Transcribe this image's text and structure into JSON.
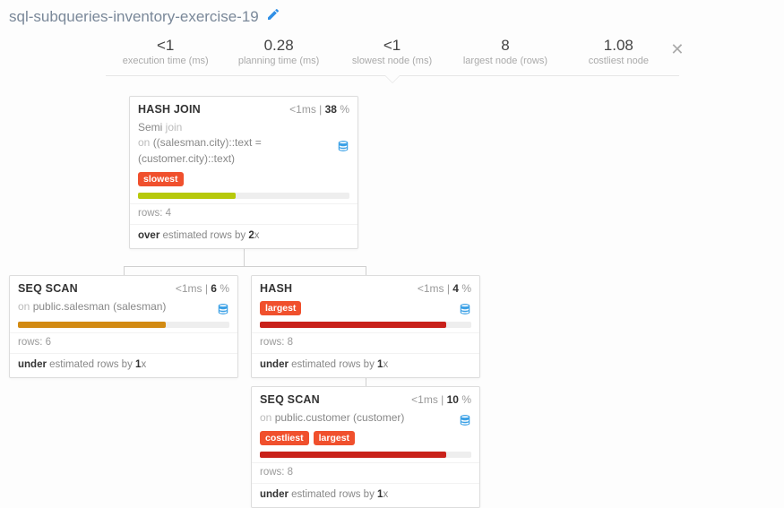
{
  "title": "sql-subqueries-inventory-exercise-19",
  "stats": {
    "execution_time": {
      "value": "<1",
      "label": "execution time (ms)"
    },
    "planning_time": {
      "value": "0.28",
      "label": "planning time (ms)"
    },
    "slowest_node": {
      "value": "<1",
      "label": "slowest node (ms)"
    },
    "largest_node": {
      "value": "8",
      "label": "largest node (rows)"
    },
    "costliest_node": {
      "value": "1.08",
      "label": "costliest node"
    }
  },
  "nodes": {
    "hashjoin": {
      "name": "HASH JOIN",
      "time": "<1ms",
      "pct": "38",
      "join_kind_prefix": "Semi",
      "join_kind_suffix": " join",
      "on_prefix": "on ",
      "on_cond": "((salesman.city)::text = (customer.city)::text)",
      "tags": [
        "slowest"
      ],
      "bar_color": "#b7c90a",
      "bar_width": "46%",
      "rows": "rows: 4",
      "est_lead": "over",
      "est_mid": " estimated rows by ",
      "est_num": "2",
      "est_suffix": "x"
    },
    "seqscan_salesman": {
      "name": "SEQ SCAN",
      "time": "<1ms",
      "pct": "6",
      "on_prefix": "on ",
      "on_text": "public.salesman (salesman)",
      "bar_color": "#d28a12",
      "bar_width": "70%",
      "rows": "rows: 6",
      "est_lead": "under",
      "est_mid": " estimated rows by ",
      "est_num": "1",
      "est_suffix": "x"
    },
    "hash": {
      "name": "HASH",
      "time": "<1ms",
      "pct": "4",
      "tags": [
        "largest"
      ],
      "bar_color": "#c9211a",
      "bar_width": "88%",
      "rows": "rows: 8",
      "est_lead": "under",
      "est_mid": " estimated rows by ",
      "est_num": "1",
      "est_suffix": "x"
    },
    "seqscan_customer": {
      "name": "SEQ SCAN",
      "time": "<1ms",
      "pct": "10",
      "on_prefix": "on ",
      "on_text": "public.customer (customer)",
      "tags": [
        "costliest",
        "largest"
      ],
      "bar_color": "#c9211a",
      "bar_width": "88%",
      "rows": "rows: 8",
      "est_lead": "under",
      "est_mid": " estimated rows by ",
      "est_num": "1",
      "est_suffix": "x"
    }
  },
  "pct_suffix": " %",
  "chart_data": {
    "type": "tree",
    "description": "PostgreSQL query plan tree",
    "root": {
      "op": "HASH JOIN",
      "time_ms": "<1",
      "cost_pct": 38,
      "rows": 4,
      "estimate": "over by 2x",
      "flags": [
        "slowest"
      ],
      "condition": "((salesman.city)::text = (customer.city)::text)",
      "join": "Semi",
      "children": [
        {
          "op": "SEQ SCAN",
          "relation": "public.salesman (salesman)",
          "time_ms": "<1",
          "cost_pct": 6,
          "rows": 6,
          "estimate": "under by 1x"
        },
        {
          "op": "HASH",
          "time_ms": "<1",
          "cost_pct": 4,
          "rows": 8,
          "estimate": "under by 1x",
          "flags": [
            "largest"
          ],
          "children": [
            {
              "op": "SEQ SCAN",
              "relation": "public.customer (customer)",
              "time_ms": "<1",
              "cost_pct": 10,
              "rows": 8,
              "estimate": "under by 1x",
              "flags": [
                "costliest",
                "largest"
              ]
            }
          ]
        }
      ]
    }
  }
}
